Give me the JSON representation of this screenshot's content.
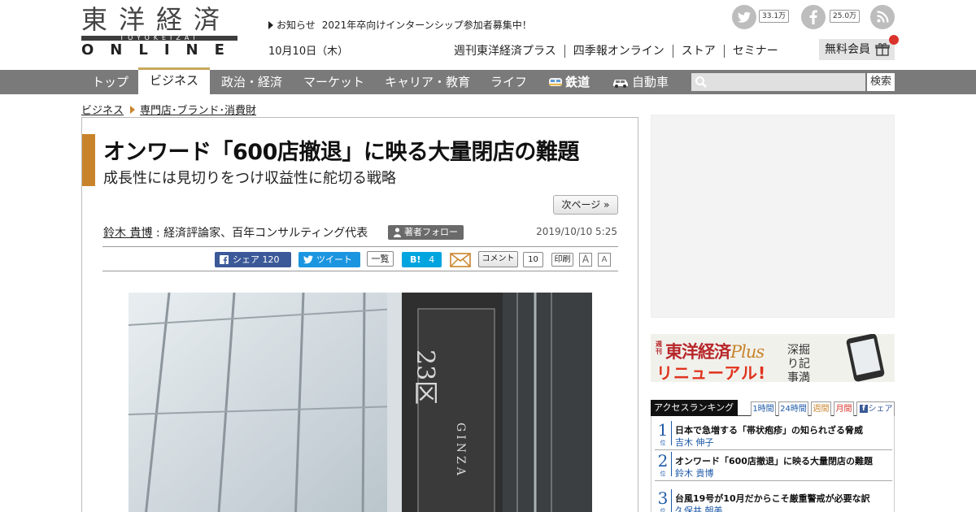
{
  "header": {
    "logo_main": "東洋経済",
    "logo_sub": "TOYOKEIZAI",
    "logo_online": "ONLINE",
    "notice_label": "お知らせ",
    "notice_text": "2021年卒向けインターンシップ参加者募集中！",
    "date": "10月10日（木）",
    "links": [
      "週刊東洋経済プラス",
      "四季報オンライン",
      "ストア",
      "セミナー"
    ],
    "free_member": "無料会員",
    "twitter_count": "33.1万",
    "facebook_count": "25.0万"
  },
  "nav": {
    "items": [
      "トップ",
      "ビジネス",
      "政治・経済",
      "マーケット",
      "キャリア・教育",
      "ライフ",
      "鉄道",
      "自動車"
    ],
    "search_placeholder": "",
    "search_button": "検索"
  },
  "breadcrumb": [
    "ビジネス",
    "専門店･ブランド･消費財"
  ],
  "article": {
    "title": "オンワード「600店撤退」に映る大量閉店の難題",
    "subtitle": "成長性には見切りをつけ収益性に舵切る戦略",
    "next_page": "次ページ »",
    "author_name": "鈴木 貴博",
    "author_desc": " : 経済評論家、百年コンサルティング代表",
    "follow": "著者フォロー",
    "date": "2019/10/10 5:25",
    "share_fb": "シェア 120",
    "share_tw": "ツイート",
    "list": "一覧",
    "hatena": "4",
    "comment": "コメント",
    "comment_count": "10",
    "print": "印刷",
    "font_large": "A",
    "font_small": "A",
    "photo_sign": "23区",
    "photo_sign_sub": "GINZA"
  },
  "sidebar": {
    "banner_weekly": "週刊",
    "banner_title": "東洋経済",
    "banner_plus": "Plus",
    "banner_renewal": "リニューアル!",
    "banner_tagline": "深掘り記事満載",
    "ranking_title": "アクセスランキング",
    "ranking_tabs": [
      "1時間",
      "24時間",
      "週間",
      "月間",
      "シェア"
    ],
    "ranking_items": [
      {
        "num": "1",
        "pos": "位",
        "title": "日本で急増する「帯状疱疹」の知られざる脅威",
        "author": "吉木 伸子"
      },
      {
        "num": "2",
        "pos": "位",
        "title": "オンワード「600店撤退」に映る大量閉店の難題",
        "author": "鈴木 貴博"
      },
      {
        "num": "3",
        "pos": "位",
        "title": "台風19号が10月だからこそ厳重警戒が必要な訳",
        "author": "久保井 朝美"
      }
    ]
  },
  "colors": {
    "accent": "#c9842b",
    "nav_bg": "#7a7a7a",
    "facebook": "#3b5998",
    "twitter": "#1b95e0",
    "hatena": "#00a4de",
    "ranking_blue": "#1e5aa8"
  }
}
